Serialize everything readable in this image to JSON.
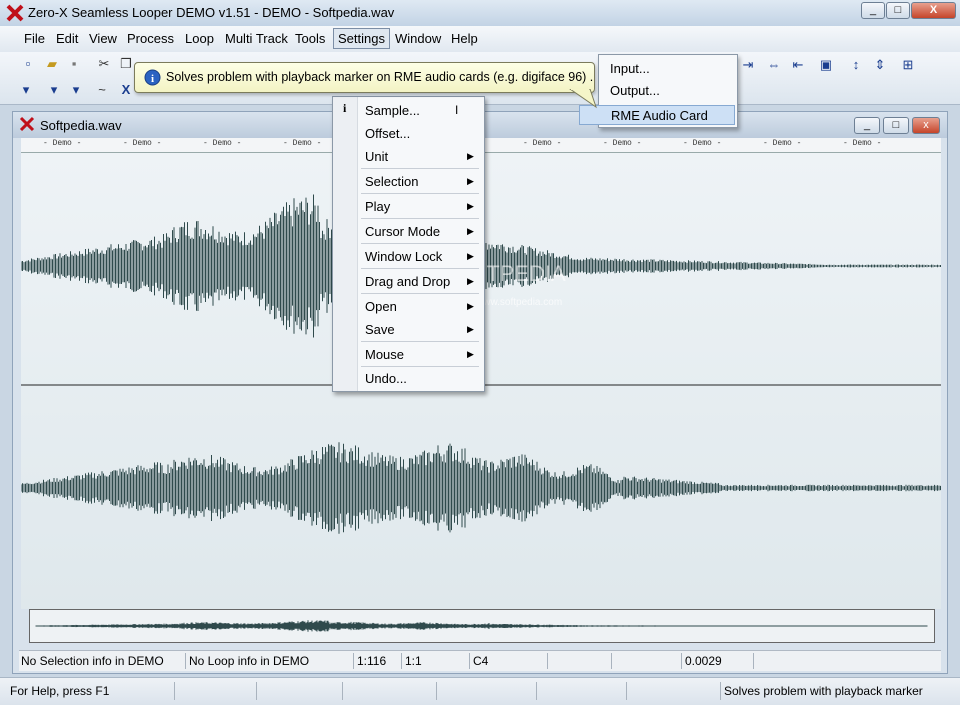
{
  "window": {
    "title": "Zero-X Seamless Looper   DEMO v1.51 - DEMO - Softpedia.wav",
    "btn_min": "_",
    "btn_max": "□",
    "btn_close": "X"
  },
  "menubar": {
    "items": [
      "File",
      "Edit",
      "View",
      "Process",
      "Loop",
      "Multi Track",
      "Tools",
      "Settings",
      "Window",
      "Help"
    ]
  },
  "child_window": {
    "title": "Softpedia.wav",
    "ruler_label": "- Demo -",
    "watermark": "SOFTPEDIA",
    "watermark_sub": "www.softpedia.com"
  },
  "child_status": {
    "selection": "No Selection info in DEMO",
    "loop": "No Loop info in DEMO",
    "ratio1": "1:116",
    "ratio2": "1:1",
    "note": "C4",
    "value": "0.0029"
  },
  "statusbar": {
    "help": "For Help, press F1",
    "hint": "Solves problem with playback marker"
  },
  "settings_menu": {
    "items": [
      {
        "label": "Sample...",
        "submenu": false
      },
      {
        "label": "Offset...",
        "submenu": false
      },
      {
        "label": "Unit",
        "submenu": true
      },
      {
        "label": "Selection",
        "submenu": true
      },
      {
        "label": "Play",
        "submenu": true
      },
      {
        "label": "Cursor Mode",
        "submenu": true
      },
      {
        "label": "Window Lock",
        "submenu": true
      },
      {
        "label": "Drag and Drop",
        "submenu": true
      },
      {
        "label": "Open",
        "submenu": true
      },
      {
        "label": "Save",
        "submenu": true
      },
      {
        "label": "Mouse",
        "submenu": true
      },
      {
        "label": "Undo...",
        "submenu": false
      }
    ]
  },
  "audio_submenu": {
    "items": [
      "Input...",
      "Output...",
      "RME Audio Card"
    ]
  },
  "tooltip": {
    "text": "Solves problem with playback marker on RME audio cards (e.g. digiface 96) ."
  },
  "colors": {
    "waveform": "#2f4a4c",
    "accent": "#cde0f5"
  }
}
